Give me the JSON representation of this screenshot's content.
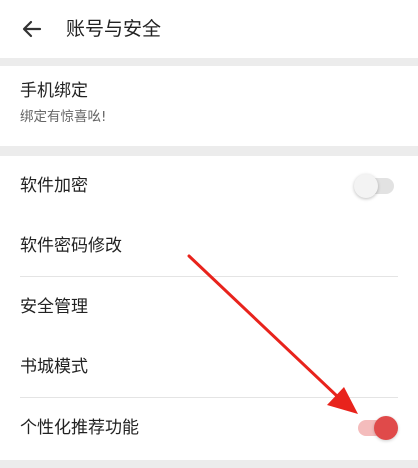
{
  "header": {
    "back_icon": "back-arrow-icon",
    "title": "账号与安全"
  },
  "phone_binding": {
    "title": "手机绑定",
    "subtitle": "绑定有惊喜吆!"
  },
  "settings": {
    "items": [
      {
        "label": "软件加密",
        "has_switch": true,
        "switch_on": false
      },
      {
        "label": "软件密码修改"
      },
      {
        "label": "安全管理"
      },
      {
        "label": "书城模式"
      },
      {
        "label": "个性化推荐功能",
        "has_switch": true,
        "switch_on": true
      }
    ]
  },
  "colors": {
    "accent": "#e04a4a",
    "accent_track": "#f4bcbc",
    "annotation_arrow": "#e8231c"
  }
}
